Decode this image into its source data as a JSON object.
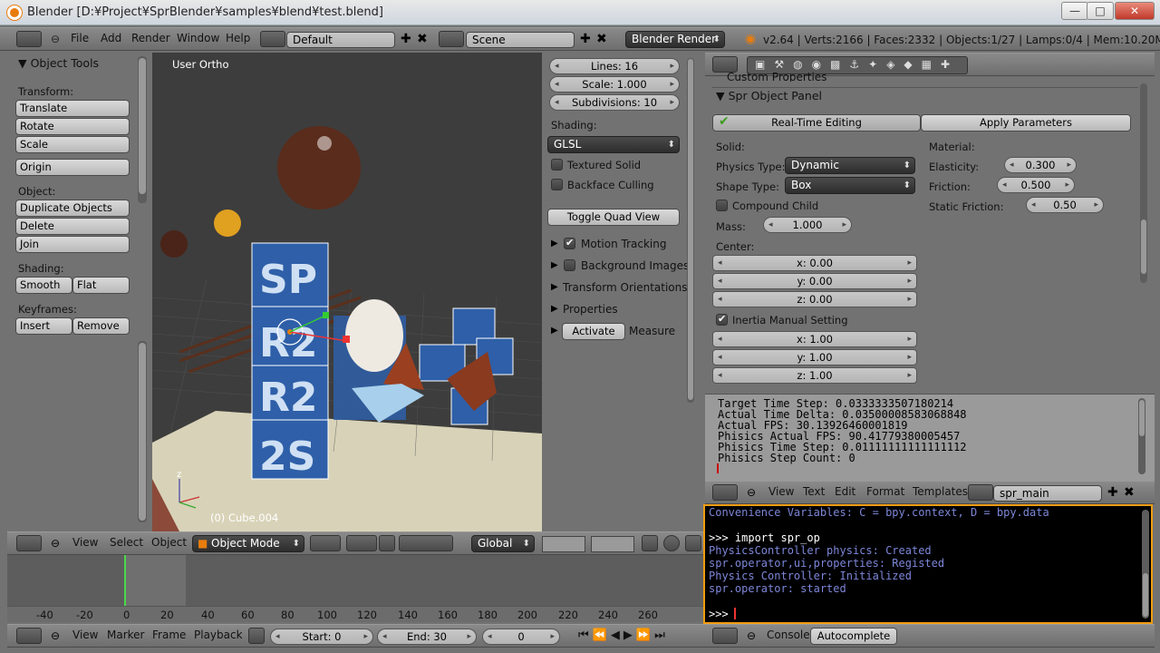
{
  "window": {
    "title": "Blender [D:¥Project¥SprBlender¥samples¥blend¥test.blend]",
    "min": "—",
    "max": "□",
    "close": "✕"
  },
  "topbar": {
    "menus": [
      "File",
      "Add",
      "Render",
      "Window",
      "Help"
    ],
    "layout": "Default",
    "scene": "Scene",
    "engine": "Blender Render",
    "stats": "v2.64 | Verts:2166 | Faces:2332 | Objects:1/27 | Lamps:0/4 | Mem:10.20M (5.82M) |"
  },
  "tools": {
    "header": "Object Tools",
    "transform_label": "Transform:",
    "translate": "Translate",
    "rotate": "Rotate",
    "scale": "Scale",
    "origin": "Origin",
    "object_label": "Object:",
    "duplicate": "Duplicate Objects",
    "delete": "Delete",
    "join": "Join",
    "shading_label": "Shading:",
    "smooth": "Smooth",
    "flat": "Flat",
    "keyframes_label": "Keyframes:",
    "insert": "Insert",
    "remove": "Remove"
  },
  "viewport": {
    "view_name": "User Ortho",
    "object_name": "(0) Cube.004",
    "header": {
      "view": "View",
      "select": "Select",
      "object": "Object",
      "mode": "Object Mode",
      "orientation": "Global"
    }
  },
  "properties_n": {
    "lines": "Lines: 16",
    "scale": "Scale: 1.000",
    "subdivisions": "Subdivisions: 10",
    "shading_label": "Shading:",
    "shading_value": "GLSL",
    "textured_solid": "Textured Solid",
    "backface_culling": "Backface Culling",
    "toggle_quad": "Toggle Quad View",
    "motion_tracking": "Motion Tracking",
    "background_images": "Background Images",
    "transform_orientations": "Transform Orientations",
    "properties": "Properties",
    "activate": "Activate",
    "measure": "Measure"
  },
  "spr_panel": {
    "custom_properties": "Custom Properties",
    "title": "Spr Object Panel",
    "realtime": "Real-Time Editing",
    "apply": "Apply Parameters",
    "solid_label": "Solid:",
    "physics_type_label": "Physics Type:",
    "physics_type": "Dynamic",
    "shape_type_label": "Shape Type:",
    "shape_type": "Box",
    "compound_child": "Compound Child",
    "mass": "Mass:",
    "mass_value": "1.000",
    "center_label": "Center:",
    "cx": "x: 0.00",
    "cy": "y: 0.00",
    "cz": "z: 0.00",
    "inertia_manual": "Inertia Manual Setting",
    "ix": "x: 1.00",
    "iy": "y: 1.00",
    "iz": "z: 1.00",
    "material_label": "Material:",
    "elasticity_label": "Elasticity:",
    "elasticity": "0.300",
    "friction_label": "Friction:",
    "friction": "0.500",
    "static_friction_label": "Static Friction:",
    "static_friction": "0.50"
  },
  "text_output": [
    "Target Time Step: 0.0333333507180214",
    "Actual Time Delta: 0.0350000858306884​8",
    "Actual FPS: 30.13926460001819",
    "Phisics Actual FPS: 90.41779380005457",
    "Phisics Time Step: 0.01111111111111112",
    "Phisics Step Count: 0"
  ],
  "text_editor_header": {
    "view": "View",
    "text": "Text",
    "edit": "Edit",
    "format": "Format",
    "templates": "Templates",
    "file": "spr_main"
  },
  "console": {
    "lines": [
      "Convenience Variables: C = bpy.context, D = bpy.data",
      "",
      ">>> import spr_op",
      "PhysicsController physics: Created",
      "spr.operator,ui,properties: Registed",
      "Physics Controller: Initialized",
      "spr.operator: started"
    ],
    "prompt": ">>> ",
    "header_console": "Console",
    "header_autocomplete": "Autocomplete"
  },
  "timeline": {
    "ticks": [
      "-40",
      "-20",
      "0",
      "20",
      "40",
      "60",
      "80",
      "100",
      "120",
      "140",
      "160",
      "180",
      "200",
      "220",
      "240",
      "260"
    ],
    "view": "View",
    "marker": "Marker",
    "frame": "Frame",
    "playback": "Playback",
    "start": "Start: 0",
    "end": "End: 30",
    "current": "0"
  }
}
